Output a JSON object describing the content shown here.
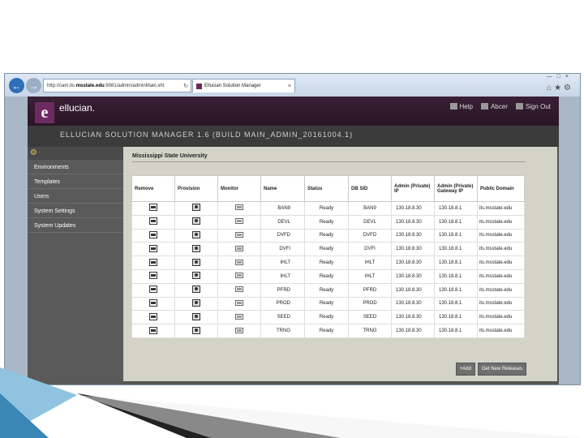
{
  "browser": {
    "url_prefix": "http://cam.its.",
    "url_domain": "msstate.edu",
    "url_suffix": ":8081/admin/adminMain.xht",
    "tab_title": "Ellucian Solution Manager"
  },
  "app": {
    "logo_letter": "e",
    "logo_text": "ellucian.",
    "banner": "ELLUCIAN SOLUTION MANAGER 1.6 (BUILD MAIN_ADMIN_20161004.1)",
    "links": {
      "help": "Help",
      "user": "Abcer",
      "signout": "Sign Out"
    }
  },
  "sidebar": {
    "items": [
      {
        "label": "Environments"
      },
      {
        "label": "Templates"
      },
      {
        "label": "Users"
      },
      {
        "label": "System Settings"
      },
      {
        "label": "System Updates"
      }
    ]
  },
  "main": {
    "org": "Mississippi State University",
    "columns": [
      "Remove",
      "Provision",
      "Monitor",
      "Name",
      "Status",
      "DB SID",
      "Admin (Private) IP",
      "Admin (Private) Gateway IP",
      "Public Domain"
    ],
    "rows": [
      {
        "name": "BAN9",
        "status": "Ready",
        "sid": "BAN9",
        "ip": "130.18.8.30",
        "gw": "130.18.8.1",
        "dom": "its.msstate.edu"
      },
      {
        "name": "DEVL",
        "status": "Ready",
        "sid": "DEVL",
        "ip": "130.18.8.30",
        "gw": "130.18.8.1",
        "dom": "its.msstate.edu"
      },
      {
        "name": "DVFD",
        "status": "Ready",
        "sid": "DVFD",
        "ip": "130.18.8.30",
        "gw": "130.18.8.1",
        "dom": "its.msstate.edu"
      },
      {
        "name": "DVFI",
        "status": "Ready",
        "sid": "DVFI",
        "ip": "130.18.8.30",
        "gw": "130.18.8.1",
        "dom": "its.msstate.edu"
      },
      {
        "name": "IHLT",
        "status": "Ready",
        "sid": "IHLT",
        "ip": "130.18.8.30",
        "gw": "130.18.8.1",
        "dom": "its.msstate.edu"
      },
      {
        "name": "IHLT",
        "status": "Ready",
        "sid": "IHLT",
        "ip": "130.18.8.30",
        "gw": "130.18.8.1",
        "dom": "its.msstate.edu"
      },
      {
        "name": "PFRD",
        "status": "Ready",
        "sid": "PFRD",
        "ip": "130.18.8.30",
        "gw": "130.18.8.1",
        "dom": "its.msstate.edu"
      },
      {
        "name": "PROD",
        "status": "Ready",
        "sid": "PROD",
        "ip": "130.18.8.30",
        "gw": "130.18.8.1",
        "dom": "its.msstate.edu"
      },
      {
        "name": "SEED",
        "status": "Ready",
        "sid": "SEED",
        "ip": "130.18.8.30",
        "gw": "130.18.8.1",
        "dom": "its.msstate.edu"
      },
      {
        "name": "TRNG",
        "status": "Ready",
        "sid": "TRNG",
        "ip": "130.18.8.30",
        "gw": "130.18.8.1",
        "dom": "its.msstate.edu"
      }
    ],
    "buttons": {
      "add": "+Add",
      "releases": "Get New Releases"
    }
  },
  "colors": {
    "brand": "#6e2b63",
    "header": "#2a1627",
    "accent_blue": "#2d6fb8"
  }
}
